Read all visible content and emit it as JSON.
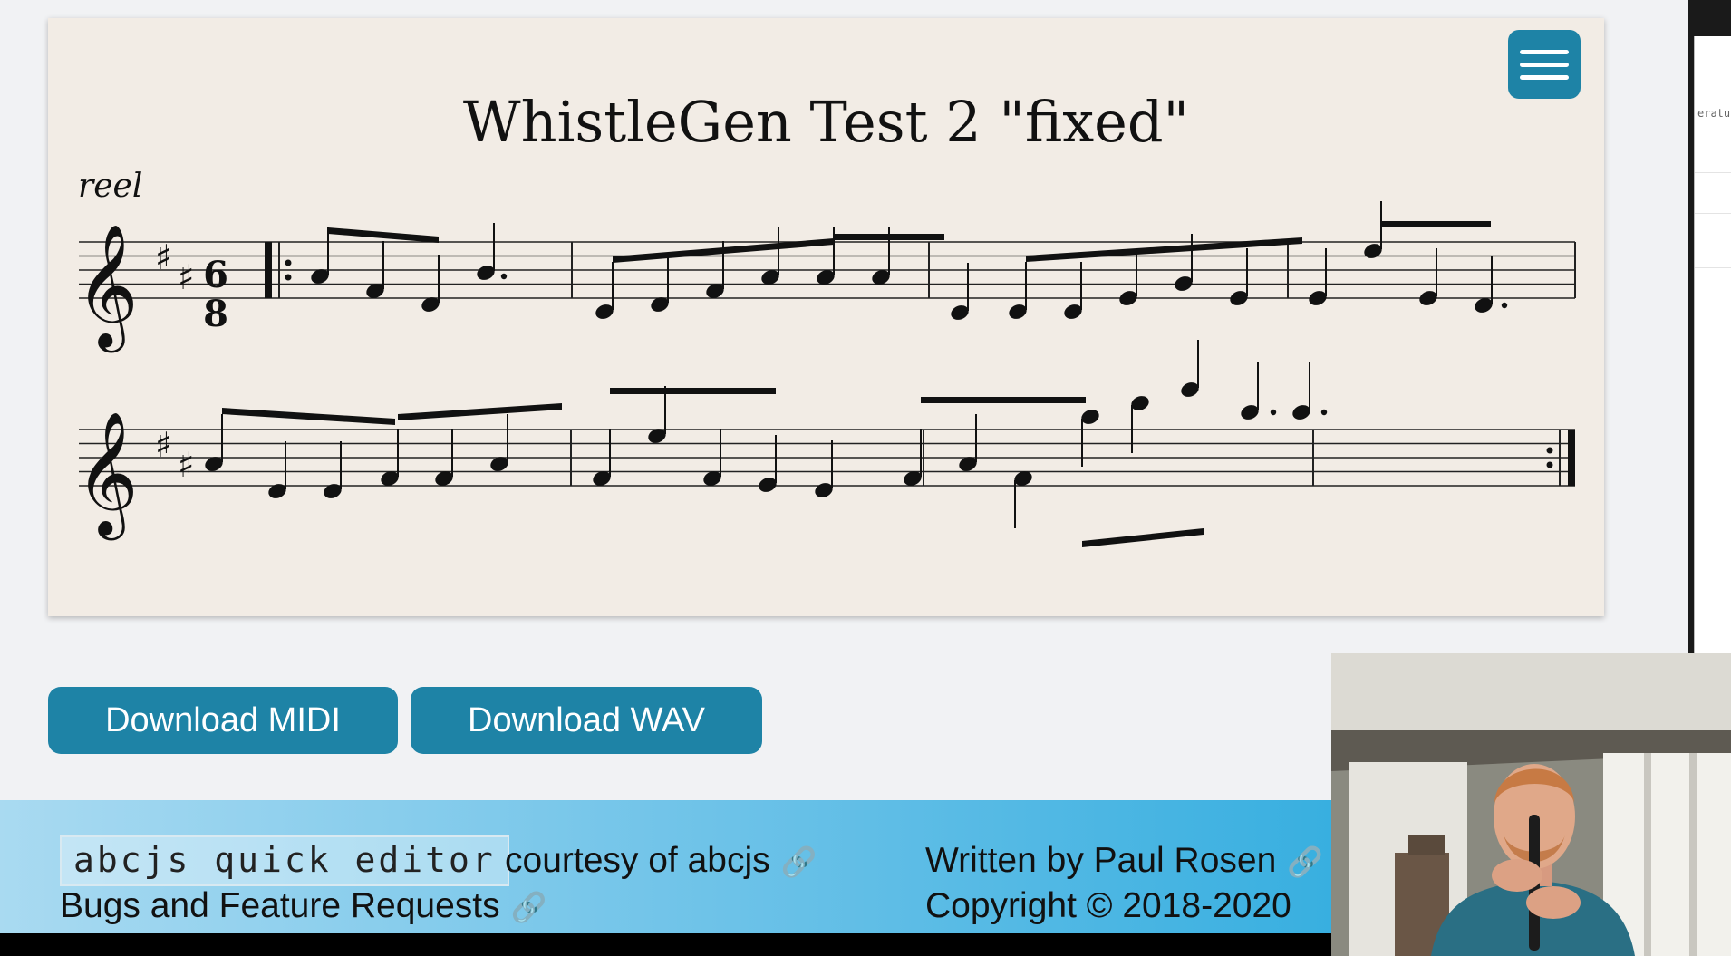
{
  "tune": {
    "title": "WhistleGen Test 2 \"fixed\"",
    "rhythm": "reel",
    "meter": {
      "numerator": "6",
      "denominator": "8"
    }
  },
  "buttons": {
    "download_midi": "Download MIDI",
    "download_wav": "Download WAV"
  },
  "footer": {
    "editor_link": "abcjs quick editor",
    "courtesy": "courtesy of abcjs",
    "bugs": "Bugs and Feature Requests",
    "written_by": "Written by Paul Rosen",
    "copyright": "Copyright © 2018-2020"
  },
  "right_window": {
    "snippet": "eratu"
  },
  "colors": {
    "accent": "#1e83a6",
    "paper": "#f2ece5",
    "footer_start": "#a9daf1",
    "footer_end": "#38afe0"
  },
  "icons": {
    "menu": "hamburger-menu-icon",
    "link": "link-icon"
  }
}
